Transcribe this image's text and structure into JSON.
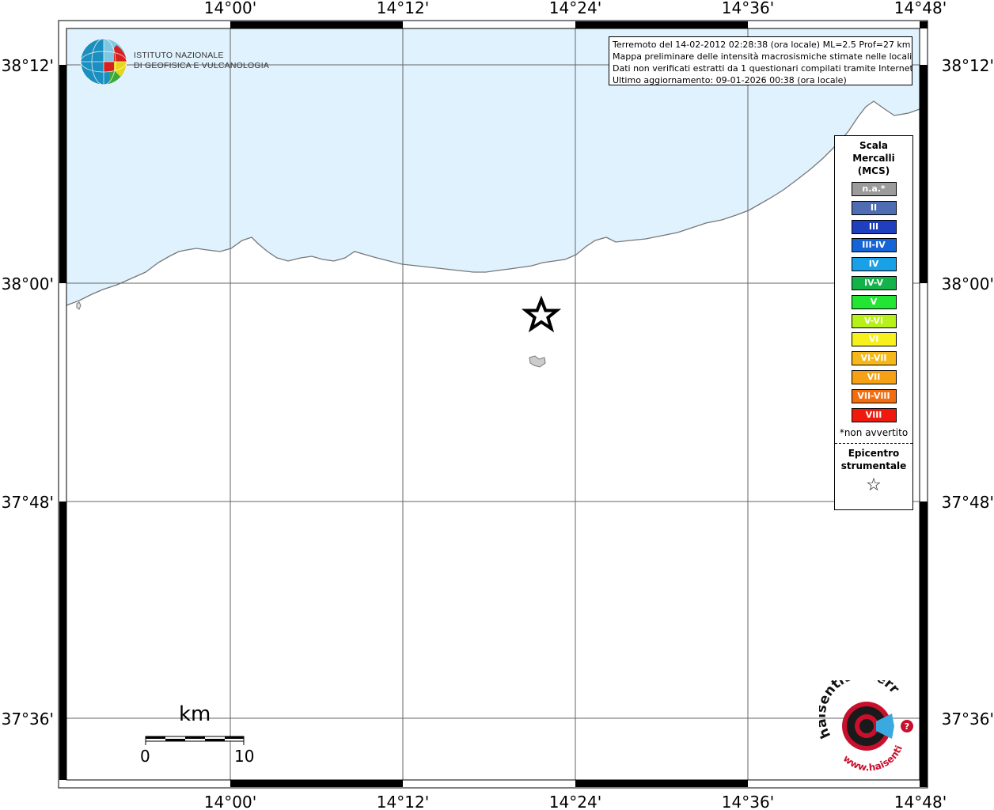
{
  "map": {
    "lon_labels": [
      "14°00'",
      "14°12'",
      "14°24'",
      "14°36'",
      "14°48'"
    ],
    "lat_labels": [
      "38°12'",
      "38°00'",
      "37°48'",
      "37°36'"
    ],
    "sea_color": "#e0f2fd",
    "land_color": "#ffffff",
    "epicenter_icon": "star-icon"
  },
  "info": {
    "line1": "Terremoto del 14-02-2012 02:28:38 (ora locale) ML=2.5 Prof=27 km",
    "line2": "Mappa preliminare delle intensità macrosismiche stimate nelle località",
    "line3": "Dati non verificati estratti da 1 questionari compilati tramite Internet.",
    "line4": "Ultimo aggiornamento: 09-01-2026 00:38 (ora locale)"
  },
  "institute": {
    "line1": "ISTITUTO NAZIONALE",
    "line2": "DI GEOFISICA E VULCANOLOGIA"
  },
  "legend": {
    "title1": "Scala",
    "title2": "Mercalli",
    "title3": "(MCS)",
    "items": [
      {
        "label": "n.a.*",
        "color": "#9b9b9b"
      },
      {
        "label": "II",
        "color": "#4f6db3"
      },
      {
        "label": "III",
        "color": "#1f3fbf"
      },
      {
        "label": "III-IV",
        "color": "#1565d6"
      },
      {
        "label": "IV",
        "color": "#1aa0e6"
      },
      {
        "label": "IV-V",
        "color": "#13b34a"
      },
      {
        "label": "V",
        "color": "#22e633"
      },
      {
        "label": "V-VI",
        "color": "#b8f01a"
      },
      {
        "label": "VI",
        "color": "#f6f01c"
      },
      {
        "label": "VI-VII",
        "color": "#f5b818"
      },
      {
        "label": "VII",
        "color": "#f5a015"
      },
      {
        "label": "VII-VIII",
        "color": "#f26d0f"
      },
      {
        "label": "VIII",
        "color": "#ee1a0e"
      }
    ],
    "note": "*non avvertito",
    "epi1": "Epicentro",
    "epi2": "strumentale",
    "epi_symbol": "☆"
  },
  "scale": {
    "title": "km",
    "zero": "0",
    "ten": "10"
  },
  "brand": {
    "text_outer": "www.haisentitoilterremoto.it",
    "text_main": "haisentitoilterremoto.it",
    "question": "?"
  }
}
